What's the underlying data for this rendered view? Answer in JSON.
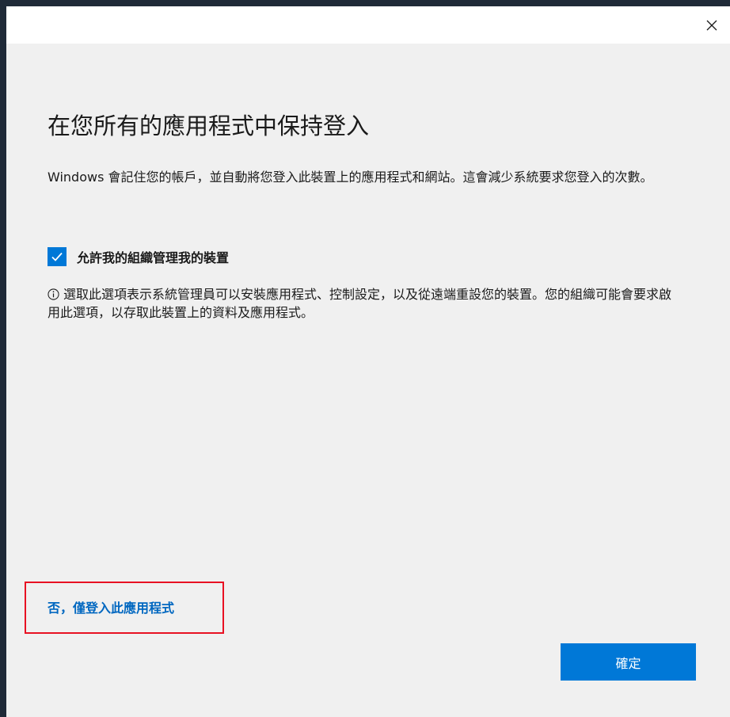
{
  "title_bar": {
    "close_icon": "close-icon"
  },
  "main": {
    "heading": "在您所有的應用程式中保持登入",
    "description": "Windows 會記住您的帳戶，並自動將您登入此裝置上的應用程式和網站。這會減少系統要求您登入的次數。",
    "checkbox": {
      "label": "允許我的組織管理我的裝置",
      "checked": true
    },
    "info": {
      "icon": "info-icon",
      "text": "選取此選項表示系統管理員可以安裝應用程式、控制設定，以及從遠端重設您的裝置。您的組織可能會要求啟用此選項，以存取此裝置上的資料及應用程式。"
    }
  },
  "footer": {
    "no_link_label": "否，僅登入此應用程式",
    "ok_button_label": "確定"
  },
  "colors": {
    "accent": "#0078d7",
    "link": "#0067c0",
    "highlight": "#e81123",
    "background": "#f0f0f0"
  }
}
